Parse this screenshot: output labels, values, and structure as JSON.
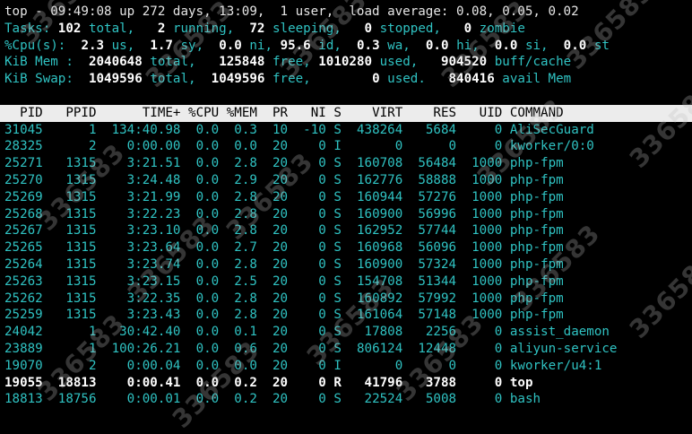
{
  "summary": {
    "line1": {
      "prefix": "top - 09:49:08 up 272 days, 13:09,  1 user,  load average: 0.08, 0.05, 0.02"
    },
    "tasks": {
      "label": "Tasks:",
      "total": "102",
      "total_label": "total,",
      "running": "2",
      "running_label": "running,",
      "sleeping": "72",
      "sleeping_label": "sleeping,",
      "stopped": "0",
      "stopped_label": "stopped,",
      "zombie": "0",
      "zombie_label": "zombie"
    },
    "cpu": {
      "label": "%Cpu(s):",
      "us": "2.3",
      "us_label": "us,",
      "sy": "1.7",
      "sy_label": "sy,",
      "ni": "0.0",
      "ni_label": "ni,",
      "id": "95.6",
      "id_label": "id,",
      "wa": "0.3",
      "wa_label": "wa,",
      "hi": "0.0",
      "hi_label": "hi,",
      "si": "0.0",
      "si_label": "si,",
      "st": "0.0",
      "st_label": "st"
    },
    "mem": {
      "label": "KiB Mem :",
      "total": "2040648",
      "total_label": "total,",
      "free": "125848",
      "free_label": "free,",
      "used": "1010280",
      "used_label": "used,",
      "buff": "904520",
      "buff_label": "buff/cache"
    },
    "swap": {
      "label": "KiB Swap:",
      "total": "1049596",
      "total_label": "total,",
      "free": "1049596",
      "free_label": "free,",
      "used": "0",
      "used_label": "used.",
      "avail": "840416",
      "avail_label": "avail Mem"
    }
  },
  "table": {
    "columns": [
      "PID",
      "PPID",
      "TIME+",
      "%CPU",
      "%MEM",
      "PR",
      "NI",
      "S",
      "VIRT",
      "RES",
      "UID",
      "COMMAND"
    ],
    "rows": [
      [
        "31045",
        "1",
        "134:40.98",
        "0.0",
        "0.3",
        "10",
        "-10",
        "S",
        "438264",
        "5684",
        "0",
        "AliSecGuard"
      ],
      [
        "28325",
        "2",
        "0:00.00",
        "0.0",
        "0.0",
        "20",
        "0",
        "I",
        "0",
        "0",
        "0",
        "kworker/0:0"
      ],
      [
        "25271",
        "1315",
        "3:21.51",
        "0.0",
        "2.8",
        "20",
        "0",
        "S",
        "160708",
        "56484",
        "1000",
        "php-fpm"
      ],
      [
        "25270",
        "1315",
        "3:24.48",
        "0.0",
        "2.9",
        "20",
        "0",
        "S",
        "162776",
        "58888",
        "1000",
        "php-fpm"
      ],
      [
        "25269",
        "1315",
        "3:21.99",
        "0.0",
        "2.8",
        "20",
        "0",
        "S",
        "160944",
        "57276",
        "1000",
        "php-fpm"
      ],
      [
        "25268",
        "1315",
        "3:22.23",
        "0.0",
        "2.8",
        "20",
        "0",
        "S",
        "160900",
        "56996",
        "1000",
        "php-fpm"
      ],
      [
        "25267",
        "1315",
        "3:23.10",
        "0.0",
        "2.8",
        "20",
        "0",
        "S",
        "162952",
        "57744",
        "1000",
        "php-fpm"
      ],
      [
        "25265",
        "1315",
        "3:23.64",
        "0.0",
        "2.7",
        "20",
        "0",
        "S",
        "160968",
        "56096",
        "1000",
        "php-fpm"
      ],
      [
        "25264",
        "1315",
        "3:23.74",
        "0.0",
        "2.8",
        "20",
        "0",
        "S",
        "160900",
        "57324",
        "1000",
        "php-fpm"
      ],
      [
        "25263",
        "1315",
        "3:23.15",
        "0.0",
        "2.5",
        "20",
        "0",
        "S",
        "154708",
        "51344",
        "1000",
        "php-fpm"
      ],
      [
        "25262",
        "1315",
        "3:22.35",
        "0.0",
        "2.8",
        "20",
        "0",
        "S",
        "160892",
        "57992",
        "1000",
        "php-fpm"
      ],
      [
        "25259",
        "1315",
        "3:23.43",
        "0.0",
        "2.8",
        "20",
        "0",
        "S",
        "161064",
        "57148",
        "1000",
        "php-fpm"
      ],
      [
        "24042",
        "1",
        "30:42.40",
        "0.0",
        "0.1",
        "20",
        "0",
        "S",
        "17808",
        "2256",
        "0",
        "assist_daemon"
      ],
      [
        "23889",
        "1",
        "100:26.21",
        "0.0",
        "0.6",
        "20",
        "0",
        "S",
        "806124",
        "12448",
        "0",
        "aliyun-service"
      ],
      [
        "19070",
        "2",
        "0:00.04",
        "0.0",
        "0.0",
        "20",
        "0",
        "I",
        "0",
        "0",
        "0",
        "kworker/u4:1"
      ],
      [
        "19055",
        "18813",
        "0:00.41",
        "0.0",
        "0.2",
        "20",
        "0",
        "R",
        "41796",
        "3788",
        "0",
        "top"
      ],
      [
        "18813",
        "18756",
        "0:00.01",
        "0.0",
        "0.2",
        "20",
        "0",
        "S",
        "22524",
        "5008",
        "0",
        "bash"
      ]
    ],
    "active_row_index": 15
  },
  "watermark": {
    "text": "336583"
  },
  "colors": {
    "background": "#000000",
    "cyan": "#2fc2c2",
    "white": "#ffffff",
    "header_bg": "#ececec",
    "header_fg": "#000000"
  }
}
